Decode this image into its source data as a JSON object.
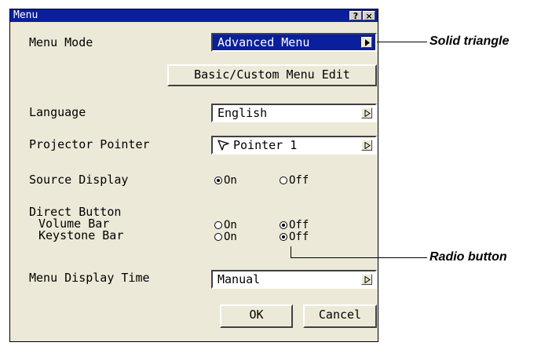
{
  "window": {
    "title": "Menu",
    "help_label": "?",
    "close_label": "×"
  },
  "menu_mode": {
    "label": "Menu Mode",
    "value": "Advanced Menu"
  },
  "basic_custom_button": "Basic/Custom Menu Edit",
  "language": {
    "label": "Language",
    "value": "English"
  },
  "projector_pointer": {
    "label": "Projector Pointer",
    "value": "Pointer 1"
  },
  "source_display": {
    "label": "Source Display",
    "on_label": "On",
    "off_label": "Off",
    "selected": "On"
  },
  "direct_button": {
    "label": "Direct Button",
    "volume_bar": {
      "label": "Volume Bar",
      "on_label": "On",
      "off_label": "Off",
      "selected": "Off"
    },
    "keystone_bar": {
      "label": "Keystone Bar",
      "on_label": "On",
      "off_label": "Off",
      "selected": "Off"
    }
  },
  "menu_display_time": {
    "label": "Menu Display Time",
    "value": "Manual"
  },
  "ok_button": "OK",
  "cancel_button": "Cancel",
  "annotations": {
    "solid_triangle": "Solid triangle",
    "radio_button": "Radio button"
  },
  "colors": {
    "titlebar": "#0a1f9c",
    "dialog_bg": "#ece9d8"
  }
}
